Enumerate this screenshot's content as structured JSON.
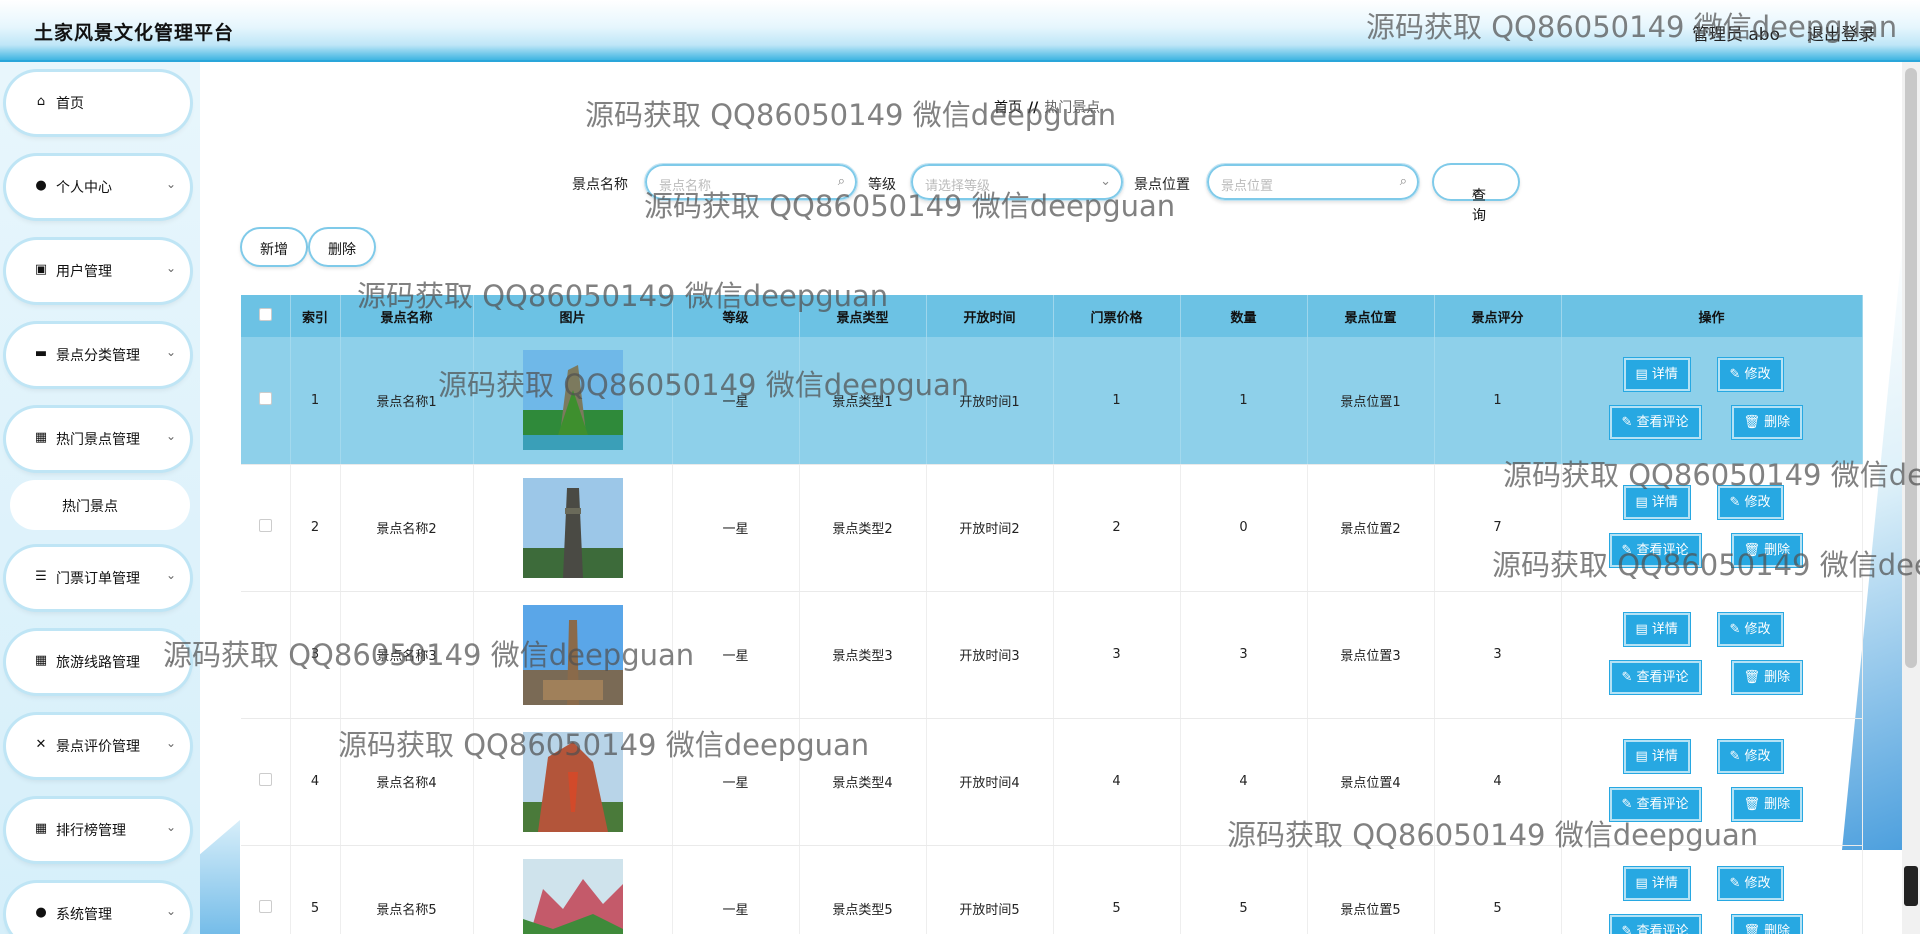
{
  "header": {
    "title": "土家风景文化管理平台",
    "user": "管理员 abo",
    "logout": "退出登录"
  },
  "sidebar": {
    "items": [
      {
        "label": "首页",
        "icon": "home-icon",
        "glyph": "⌂"
      },
      {
        "label": "个人中心",
        "icon": "user-icon",
        "glyph": "●"
      },
      {
        "label": "用户管理",
        "icon": "clipboard-icon",
        "glyph": "▣"
      },
      {
        "label": "景点分类管理",
        "icon": "book-icon",
        "glyph": "▬"
      },
      {
        "label": "热门景点管理",
        "icon": "grid-icon",
        "glyph": "▦"
      },
      {
        "label": "门票订单管理",
        "icon": "sliders-icon",
        "glyph": "☰"
      },
      {
        "label": "旅游线路管理",
        "icon": "grid-icon",
        "glyph": "▦"
      },
      {
        "label": "景点评价管理",
        "icon": "bow-icon",
        "glyph": "✕"
      },
      {
        "label": "排行榜管理",
        "icon": "grid-icon",
        "glyph": "▦"
      },
      {
        "label": "系统管理",
        "icon": "user-icon",
        "glyph": "●"
      }
    ],
    "sub_item": "热门景点"
  },
  "breadcrumb": {
    "home": "首页",
    "sep": "//",
    "current": "热门景点"
  },
  "search": {
    "name_label": "景点名称",
    "name_placeholder": "景点名称",
    "level_label": "等级",
    "level_placeholder": "请选择等级",
    "location_label": "景点位置",
    "location_placeholder": "景点位置",
    "query_label": "查询"
  },
  "actions": {
    "add": "新增",
    "delete": "删除"
  },
  "table": {
    "headers": [
      "索引",
      "景点名称",
      "图片",
      "等级",
      "景点类型",
      "开放时间",
      "门票价格",
      "数量",
      "景点位置",
      "景点评分",
      "操作"
    ],
    "rows": [
      {
        "index": "1",
        "name": "景点名称1",
        "level": "一星",
        "type": "景点类型1",
        "open": "开放时间1",
        "price": "1",
        "qty": "1",
        "location": "景点位置1",
        "score": "1"
      },
      {
        "index": "2",
        "name": "景点名称2",
        "level": "一星",
        "type": "景点类型2",
        "open": "开放时间2",
        "price": "2",
        "qty": "0",
        "location": "景点位置2",
        "score": "7"
      },
      {
        "index": "3",
        "name": "景点名称3",
        "level": "一星",
        "type": "景点类型3",
        "open": "开放时间3",
        "price": "3",
        "qty": "3",
        "location": "景点位置3",
        "score": "3"
      },
      {
        "index": "4",
        "name": "景点名称4",
        "level": "一星",
        "type": "景点类型4",
        "open": "开放时间4",
        "price": "4",
        "qty": "4",
        "location": "景点位置4",
        "score": "4"
      },
      {
        "index": "5",
        "name": "景点名称5",
        "level": "一星",
        "type": "景点类型5",
        "open": "开放时间5",
        "price": "5",
        "qty": "5",
        "location": "景点位置5",
        "score": "5"
      }
    ],
    "op_labels": {
      "detail": "详情",
      "edit": "修改",
      "review": "查看评论",
      "remove": "删除"
    }
  },
  "watermark": "源码获取 QQ86050149 微信deepguan",
  "colors": {
    "accent": "#27a8e2",
    "header_row": "#6cc2e4",
    "highlight_row": "#8ed0ea"
  }
}
